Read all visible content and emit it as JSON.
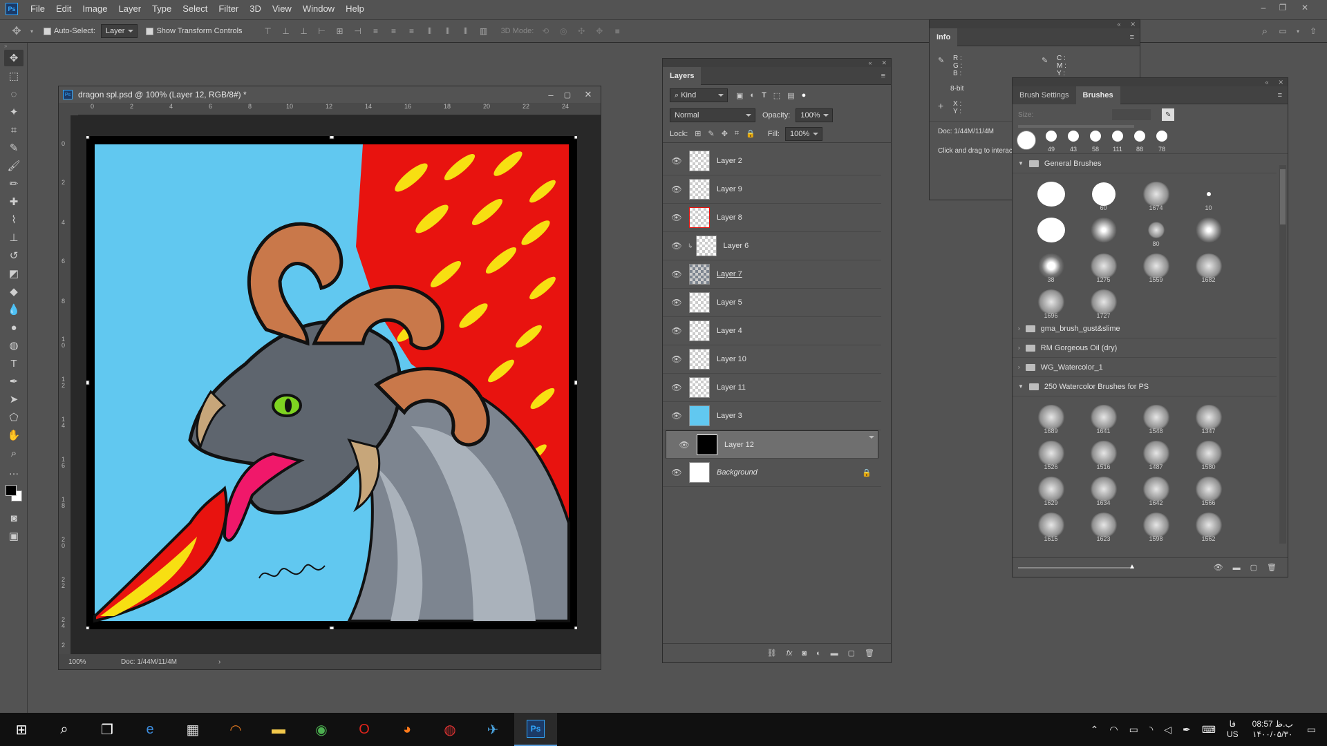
{
  "menubar": {
    "logo": "Ps",
    "items": [
      "File",
      "Edit",
      "Image",
      "Layer",
      "Type",
      "Select",
      "Filter",
      "3D",
      "View",
      "Window",
      "Help"
    ]
  },
  "options": {
    "auto_select_label": "Auto-Select:",
    "auto_select_target": "Layer",
    "show_transform_label": "Show Transform Controls",
    "mode_3d_label": "3D Mode:"
  },
  "document": {
    "title": "dragon spl.psd @ 100% (Layer 12, RGB/8#) *",
    "zoom": "100%",
    "doc_info": "Doc: 1/44M/11/4M",
    "ruler_h": [
      "0",
      "2",
      "4",
      "6",
      "8",
      "10",
      "12",
      "14",
      "16",
      "18",
      "20",
      "22",
      "24"
    ],
    "ruler_v": [
      "0",
      "2",
      "4",
      "6",
      "8",
      "1 0",
      "1 2",
      "1 4",
      "1 6",
      "1 8",
      "2 0",
      "2 2",
      "2 4",
      "2"
    ]
  },
  "layers": {
    "tab": "Layers",
    "filter_kind": "Kind",
    "blend_mode": "Normal",
    "opacity_label": "Opacity:",
    "opacity": "100%",
    "lock_label": "Lock:",
    "fill_label": "Fill:",
    "fill": "100%",
    "items": [
      {
        "name": "Layer 2"
      },
      {
        "name": "Layer 9"
      },
      {
        "name": "Layer 8"
      },
      {
        "name": "Layer 6"
      },
      {
        "name": "Layer 7"
      },
      {
        "name": "Layer 5"
      },
      {
        "name": "Layer 4"
      },
      {
        "name": "Layer 10"
      },
      {
        "name": "Layer 11"
      },
      {
        "name": "Layer 3"
      },
      {
        "name": "Layer 12"
      },
      {
        "name": "Background"
      }
    ]
  },
  "info": {
    "tab": "Info",
    "r": "R :",
    "g": "G :",
    "b": "B :",
    "c": "C :",
    "m": "M :",
    "y": "Y :",
    "bit": "8-bit",
    "x": "X :",
    "yy": "Y :",
    "doc": "Doc: 1/44M/11/4M",
    "hint": "Click and drag to interact"
  },
  "brushes": {
    "tab_settings": "Brush Settings",
    "tab_brushes": "Brushes",
    "size_label": "Size:",
    "recent": [
      "49",
      "43",
      "58",
      "111",
      "88",
      "78"
    ],
    "general_folder": "General Brushes",
    "general": [
      "",
      "60",
      "1674",
      "10",
      "",
      "",
      "80",
      "",
      "38",
      "1275",
      "1559",
      "1682",
      "1696",
      "1727"
    ],
    "folders": [
      "gma_brush_gust&slime",
      "RM Gorgeous Oil (dry)",
      "WG_Watercolor_1",
      "250 Watercolor Brushes for PS"
    ],
    "watercolor": [
      "1689",
      "1641",
      "1548",
      "1347",
      "1526",
      "1516",
      "1487",
      "1580",
      "1629",
      "1634",
      "1642",
      "1566",
      "1615",
      "1623",
      "1598",
      "1562"
    ]
  },
  "taskbar": {
    "time": "08:57 ب.ظ",
    "date": "۱۴۰۰/۰۵/۳۰",
    "lang": "فا",
    "region": "US"
  }
}
